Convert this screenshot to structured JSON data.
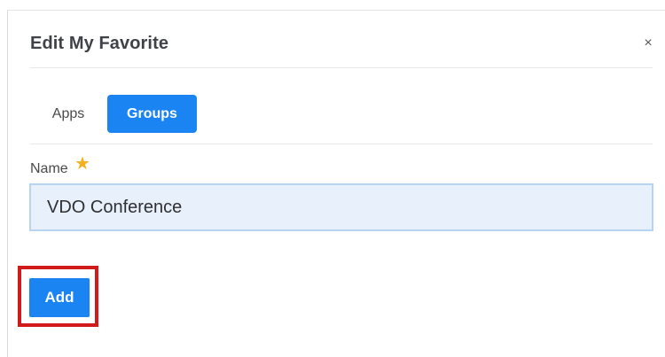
{
  "modal": {
    "title": "Edit My Favorite",
    "close_icon": "close-icon",
    "close_glyph": "×"
  },
  "tabs": [
    {
      "label": "Apps",
      "active": false
    },
    {
      "label": "Groups",
      "active": true
    }
  ],
  "form": {
    "name_label": "Name",
    "required_icon": "star-icon",
    "required_glyph": "★",
    "name_value": "VDO Conference",
    "add_label": "Add"
  },
  "colors": {
    "accent": "#1a84f2",
    "required": "#f2b01e",
    "highlight": "#d11a1a",
    "input_bg": "#e8f0fb"
  }
}
